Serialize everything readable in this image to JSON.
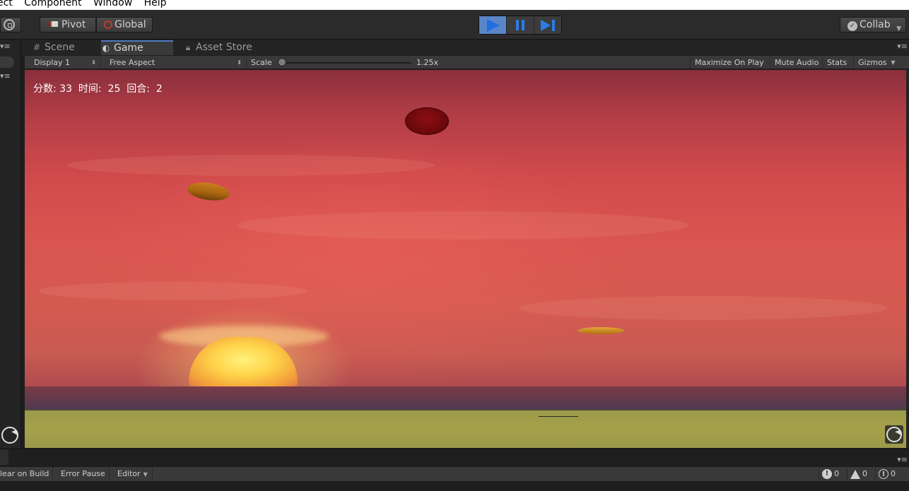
{
  "menu": [
    "ect",
    "Component",
    "Window",
    "Help"
  ],
  "toolbar": {
    "pivot_label": "Pivot",
    "global_label": "Global",
    "collab_label": "Collab"
  },
  "tabs": [
    {
      "label": "Scene",
      "icon": "grid-icon"
    },
    {
      "label": "Game",
      "icon": "pacman-icon",
      "active": true
    },
    {
      "label": "Asset Store",
      "icon": "lock-icon"
    }
  ],
  "gamebar": {
    "display": "Display 1",
    "aspect": "Free Aspect",
    "scale_label": "Scale",
    "scale_value": "1.25x",
    "maximize": "Maximize On Play",
    "mute": "Mute Audio",
    "stats": "Stats",
    "gizmos": "Gizmos"
  },
  "hud": {
    "score_label": "分数:",
    "score": "33",
    "time_label": "时间:",
    "time": "25",
    "round_label": "回合:",
    "round": "2"
  },
  "console": {
    "clear_on_build": "lear on Build",
    "error_pause": "Error Pause",
    "editor": "Editor",
    "info_count": "0",
    "warn_count": "0",
    "error_count": "0"
  },
  "colors": {
    "play_active": "#5a86c8",
    "accent_blue": "#2b7ce8",
    "sky_mid": "#d04a4c",
    "ground": "#a5a04a",
    "disc_red": "#8a0f12",
    "disc_orange": "#c87f1b"
  }
}
